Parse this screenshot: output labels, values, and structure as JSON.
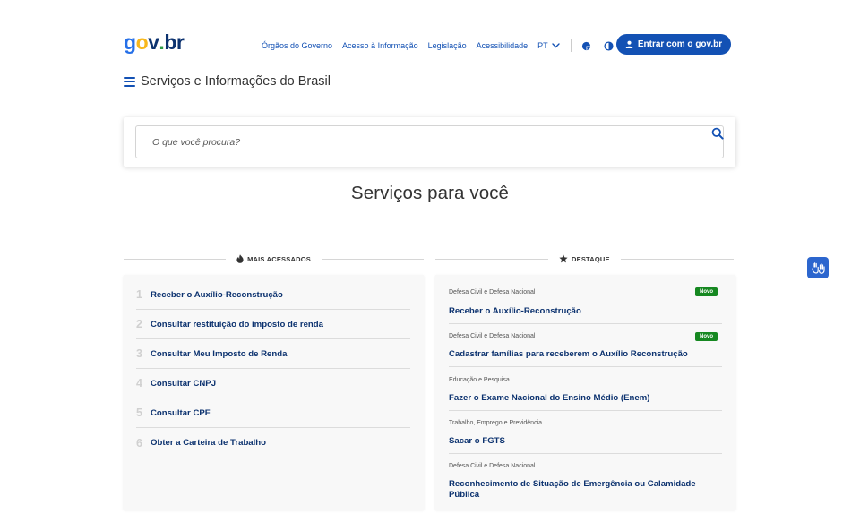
{
  "header": {
    "logo": {
      "g": "g",
      "o": "o",
      "v": "v",
      "dot": ".",
      "br": "br"
    },
    "nav": [
      {
        "label": "Órgãos do Governo"
      },
      {
        "label": "Acesso à Informação"
      },
      {
        "label": "Legislação"
      },
      {
        "label": "Acessibilidade"
      }
    ],
    "language": "PT",
    "icons": [
      "chevron-down-icon",
      "color-palette-icon",
      "contrast-icon",
      "user-icon"
    ],
    "login_label": "Entrar com o gov.br"
  },
  "menu": {
    "title": "Serviços e Informações do Brasil"
  },
  "search": {
    "placeholder": "O que você procura?",
    "value": ""
  },
  "section": {
    "title": "Serviços para você"
  },
  "most_accessed": {
    "heading": "MAIS ACESSADOS",
    "items": [
      {
        "rank": "1",
        "label": "Receber o Auxílio-Reconstrução"
      },
      {
        "rank": "2",
        "label": "Consultar restituição do imposto de renda"
      },
      {
        "rank": "3",
        "label": "Consultar Meu Imposto de Renda"
      },
      {
        "rank": "4",
        "label": "Consultar CNPJ"
      },
      {
        "rank": "5",
        "label": "Consultar CPF"
      },
      {
        "rank": "6",
        "label": "Obter a Carteira de Trabalho"
      }
    ]
  },
  "featured": {
    "heading": "DESTAQUE",
    "items": [
      {
        "category": "Defesa Civil e Defesa Nacional",
        "title": "Receber o Auxílio-Reconstrução",
        "badge": "Novo"
      },
      {
        "category": "Defesa Civil e Defesa Nacional",
        "title": "Cadastrar famílias para receberem o Auxílio Reconstrução",
        "badge": "Novo"
      },
      {
        "category": "Educação e Pesquisa",
        "title": "Fazer o Exame Nacional do Ensino Médio (Enem)"
      },
      {
        "category": "Trabalho, Emprego e Previdência",
        "title": "Sacar o FGTS"
      },
      {
        "category": "Defesa Civil e Defesa Nacional",
        "title": "Reconhecimento de Situação de Emergência ou Calamidade Pública"
      }
    ]
  },
  "colors": {
    "primary": "#1351b4",
    "dark_blue": "#0c326f",
    "badge_green": "#168821"
  }
}
